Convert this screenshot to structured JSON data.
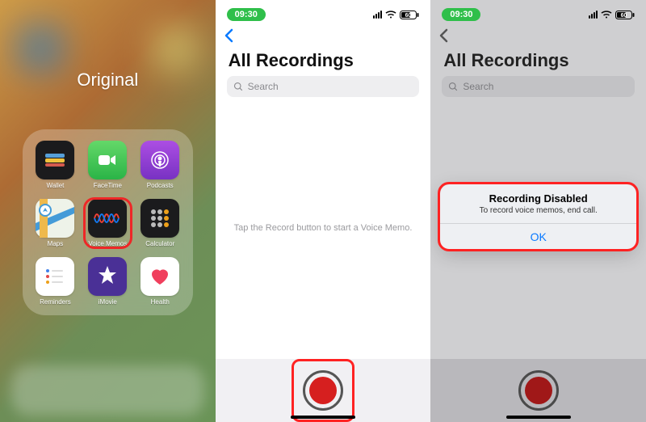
{
  "panel1": {
    "header_label": "Original",
    "apps": [
      {
        "name": "Wallet"
      },
      {
        "name": "FaceTime"
      },
      {
        "name": "Podcasts"
      },
      {
        "name": "Maps"
      },
      {
        "name": "Voice Memos"
      },
      {
        "name": "Calculator"
      },
      {
        "name": "Reminders"
      },
      {
        "name": "iMovie"
      },
      {
        "name": "Health"
      }
    ]
  },
  "statusbar": {
    "time": "09:30",
    "battery_text": "60"
  },
  "voicememos": {
    "title": "All Recordings",
    "search_placeholder": "Search",
    "empty_hint": "Tap the Record button to start a Voice Memo."
  },
  "alert": {
    "title": "Recording Disabled",
    "message": "To record voice memos, end call.",
    "ok_label": "OK"
  }
}
